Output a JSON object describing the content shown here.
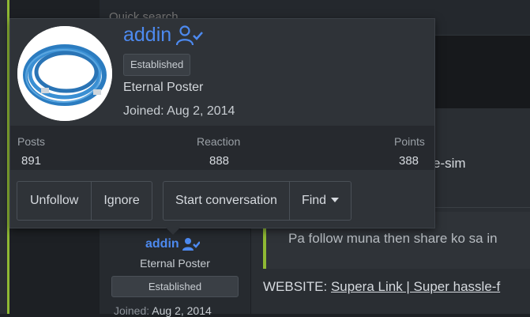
{
  "search": {
    "placeholder": "Quick search"
  },
  "post": {
    "text_fragment": "e-sim",
    "quote": "Pa follow muna then share ko sa in",
    "website_label": "WEBSITE:",
    "website_link": "Supera Link | Super hassle-f"
  },
  "sidebar_user": {
    "name": "addin",
    "title": "Eternal Poster",
    "badge": "Established",
    "joined_label": "Joined:",
    "joined_date": "Aug 2, 2014"
  },
  "popup": {
    "username": "addin",
    "badge": "Established",
    "user_title": "Eternal Poster",
    "joined_label": "Joined:",
    "joined_date": "Aug 2, 2014",
    "stats": [
      {
        "label": "Posts",
        "value": "891"
      },
      {
        "label": "Reaction",
        "value": "888"
      },
      {
        "label": "Points",
        "value": "388"
      }
    ],
    "buttons": {
      "unfollow": "Unfollow",
      "ignore": "Ignore",
      "start_conversation": "Start conversation",
      "find": "Find"
    }
  },
  "colors": {
    "accent_green": "#8fb934",
    "username_blue": "#4d8af0"
  },
  "icons": {
    "user_check": "user-check-icon",
    "caret": "caret-down-icon"
  }
}
